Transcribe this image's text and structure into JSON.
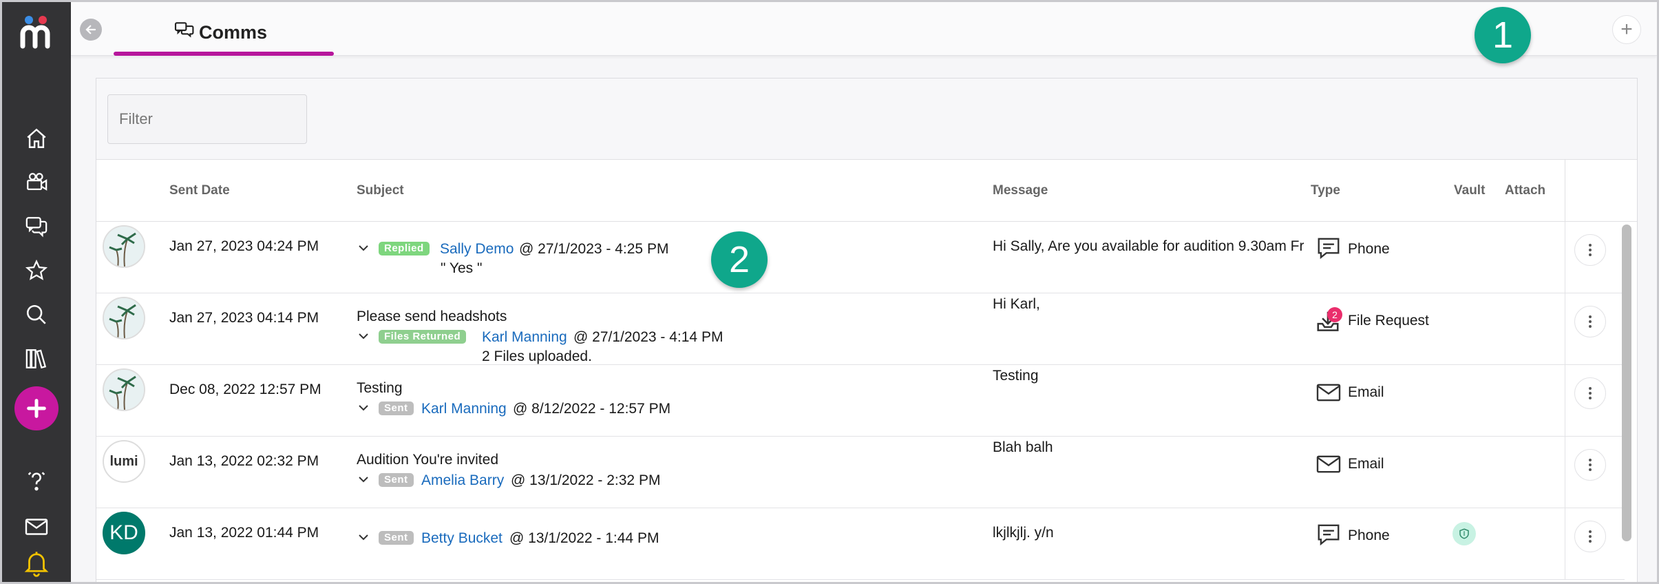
{
  "header": {
    "tab_label": "Comms",
    "plus_label": "+"
  },
  "markers": {
    "one": "1",
    "two": "2"
  },
  "filter": {
    "placeholder": "Filter"
  },
  "columns": {
    "sent_date": "Sent Date",
    "subject": "Subject",
    "message": "Message",
    "type": "Type",
    "vault": "Vault",
    "attach": "Attach"
  },
  "rows": [
    {
      "date": "Jan 27, 2023 04:24 PM",
      "status": "Replied",
      "contact": "Sally Demo",
      "when": "@ 27/1/2023 - 4:25 PM",
      "reply": "\" Yes \"",
      "message": "Hi Sally, Are you available for audition 9.30am Fri",
      "type": "Phone"
    },
    {
      "date": "Jan 27, 2023 04:14 PM",
      "subject": "Please send headshots",
      "status": "Files Returned",
      "contact": "Karl Manning",
      "when": "@ 27/1/2023 - 4:14 PM",
      "note": "2 Files uploaded.",
      "message": "Hi Karl,",
      "type": "File Request",
      "badge_count": "2"
    },
    {
      "date": "Dec 08, 2022 12:57 PM",
      "subject": "Testing",
      "status": "Sent",
      "contact": "Karl Manning",
      "when": "@ 8/12/2022 - 12:57 PM",
      "message": "Testing",
      "type": "Email"
    },
    {
      "date": "Jan 13, 2022 02:32 PM",
      "subject": "Audition You're invited",
      "status": "Sent",
      "contact": "Amelia Barry",
      "when": "@ 13/1/2022 - 2:32 PM",
      "message": "Blah balh",
      "type": "Email",
      "avatar_text": "lumi"
    },
    {
      "date": "Jan 13, 2022 01:44 PM",
      "status": "Sent",
      "contact": "Betty Bucket",
      "when": "@ 13/1/2022 - 1:44 PM",
      "message": "lkjlkjlj. y/n",
      "type": "Phone",
      "avatar_text": "KD"
    }
  ],
  "colors": {
    "rail": "#333335",
    "accent": "#b7169c",
    "marker": "#0fa78b",
    "link": "#1a6bbd"
  }
}
